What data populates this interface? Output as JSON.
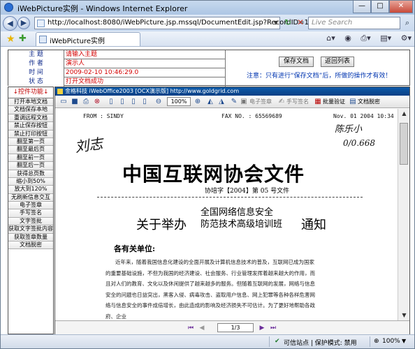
{
  "window": {
    "title": "iWebPicture实例 - Windows Internet Explorer",
    "minimize": "—",
    "maximize": "□",
    "close": "✕"
  },
  "navbar": {
    "back_glyph": "◀",
    "forward_glyph": "▶",
    "url": "http://localhost:8080/iWebPicture.jsp.mssql/DocumentEdit.jsp?RecordID=1234233989425",
    "search_placeholder": "Live Search"
  },
  "tab": {
    "label": "iWebPicture实例"
  },
  "form": {
    "fields": [
      {
        "key": "主  题",
        "value": "请输入主题"
      },
      {
        "key": "作  者",
        "value": "演示人"
      },
      {
        "key": "时  间",
        "value": "2009-02-10 10:46:29.0"
      },
      {
        "key": "状  态",
        "value": "打开文档成功"
      }
    ],
    "save_button": "保存文档",
    "back_button": "返回列表",
    "notice": "注意：只有进行“保存文档”后，所做的操作才有效！"
  },
  "sidebar": {
    "heading": "↓控件功能↓",
    "items": [
      "打开本地文档",
      "文档保存本地",
      "重调远程文档",
      "禁止保存按钮",
      "禁止打印按钮",
      "翻至第一页",
      "翻至最后页",
      "翻至前一页",
      "翻至后一页",
      "获得总页数",
      "缩小到50%",
      "放大到120%",
      "无刷新信息交互",
      "电子签章",
      "手写签名",
      "文字签批",
      "获取文字签批内容",
      "获取签章数量",
      "文档脱密"
    ]
  },
  "control": {
    "titlebar": "金格科技 iWebOffice2003 [OCX演示版]  http://www.goldgrid.com",
    "zoom": "100%",
    "tool_seal": "电子签章",
    "tool_handwrite": "手写签名",
    "tool_verify": "批量验证",
    "tool_declassify": "文档脱密",
    "page_indicator": "1/3"
  },
  "document": {
    "from": "FROM : SINDY",
    "fax": "FAX NO. : 65569689",
    "date": "Nov. 01 2004 10:34",
    "handwriting": "刘志",
    "handwriting_right1": "陈乐小",
    "handwriting_right2": "0/0.668",
    "title": "中国互联网协会文件",
    "number": "协培字【2004】第 05 号文件",
    "sub_left": "关于举办",
    "sub_mid_1": "全国网络信息安全",
    "sub_mid_2": "防范技术高级培训班",
    "sub_right": "通知",
    "greeting": "各有关单位:",
    "lines": [
      "近年来，随着我国信息化建设的全面开展及计算机信息技术的普及，互联网已成为国家",
      "的重要基础设施，不但为我国的经济建设、社会服务、行业管理发挥着越来越大的作用，而",
      "且对人们的教育、文化以及休闲提供了越来越多的服务。但随着互联网的发展，网络与信息",
      "安全的问题也日益突出，黑客入侵、病毒攻击、盗取用户信息、网上犯罪等各种各样危害网",
      "络与信息安全的事件成倍增长，由此造成的影响及经济损失不可估计。为了更好地帮助各政",
      "府、企业"
    ]
  },
  "statusbar": {
    "zone": "可信站点 | 保护模式: 禁用",
    "zoom": "100%"
  }
}
